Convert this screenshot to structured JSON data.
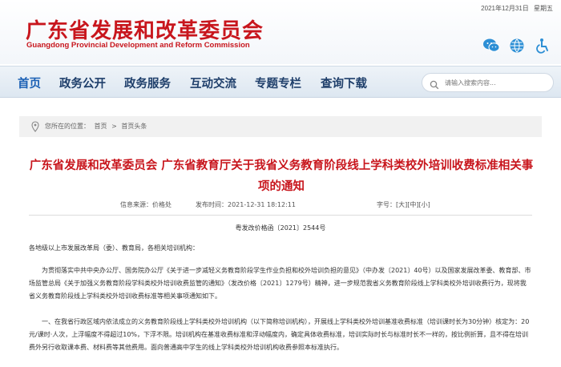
{
  "header": {
    "title": "广东省发展和改革委员会",
    "subtitle": "Guangdong Provincial Development and Reform Commission",
    "date": "2021年12月31日",
    "weekday": "星期五",
    "icons": [
      "wechat-icon",
      "globe-icon",
      "accessibility-icon"
    ]
  },
  "nav": {
    "items": [
      {
        "label": "首页"
      },
      {
        "label": "政务公开"
      },
      {
        "label": "政务服务"
      },
      {
        "label": "互动交流"
      },
      {
        "label": "专题专栏"
      },
      {
        "label": "查询下载"
      }
    ],
    "search_placeholder": "请输入搜索内容..."
  },
  "breadcrumb": {
    "prefix": "您所在的位置：",
    "items": [
      "首页",
      "首页头条"
    ],
    "separator": ">"
  },
  "article": {
    "title": "广东省发展和改革委员会 广东省教育厅关于我省义务教育阶段线上学科类校外培训收费标准相关事项的通知",
    "source": "信息来源：价格处",
    "time": "发布时间：2021-12-31 18:12:11",
    "font_size_label": "字号：",
    "font_sizes": [
      "[大]",
      "[中]",
      "[小]"
    ],
    "doc_number": "粤发改价格函〔2021〕2544号",
    "paragraphs": [
      "各地级以上市发展改革局（委）、教育局，各相关培训机构：",
      "为贯彻落实中共中央办公厅、国务院办公厅《关于进一步减轻义务教育阶段学生作业负担和校外培训负担的意见》（中办发〔2021〕40号）以及国家发展改革委、教育部、市场监管总局《关于加强义务教育阶段学科类校外培训收费监管的通知》（发改价格〔2021〕1279号）精神，进一步规范我省义务教育阶段线上学科类校外培训收费行为，现将我省义务教育阶段线上学科类校外培训收费标准等相关事项通知如下。",
      "一、在我省行政区域内依法成立的义务教育阶段线上学科类校外培训机构（以下简称培训机构），开展线上学科类校外培训基准收费标准（培训课时长为30分钟）核定为：20元/课时·人次，上浮幅度不得超过10%，下浮不限。培训机构在基准收费标准和浮动幅度内，确定具体收费标准，培训实际时长与标准时长不一样的，按比例折算，且不得在培训费外另行收取课本费、材料费等其他费用。面向普通高中学生的线上学科类校外培训机构收费参照本标准执行。"
    ]
  }
}
